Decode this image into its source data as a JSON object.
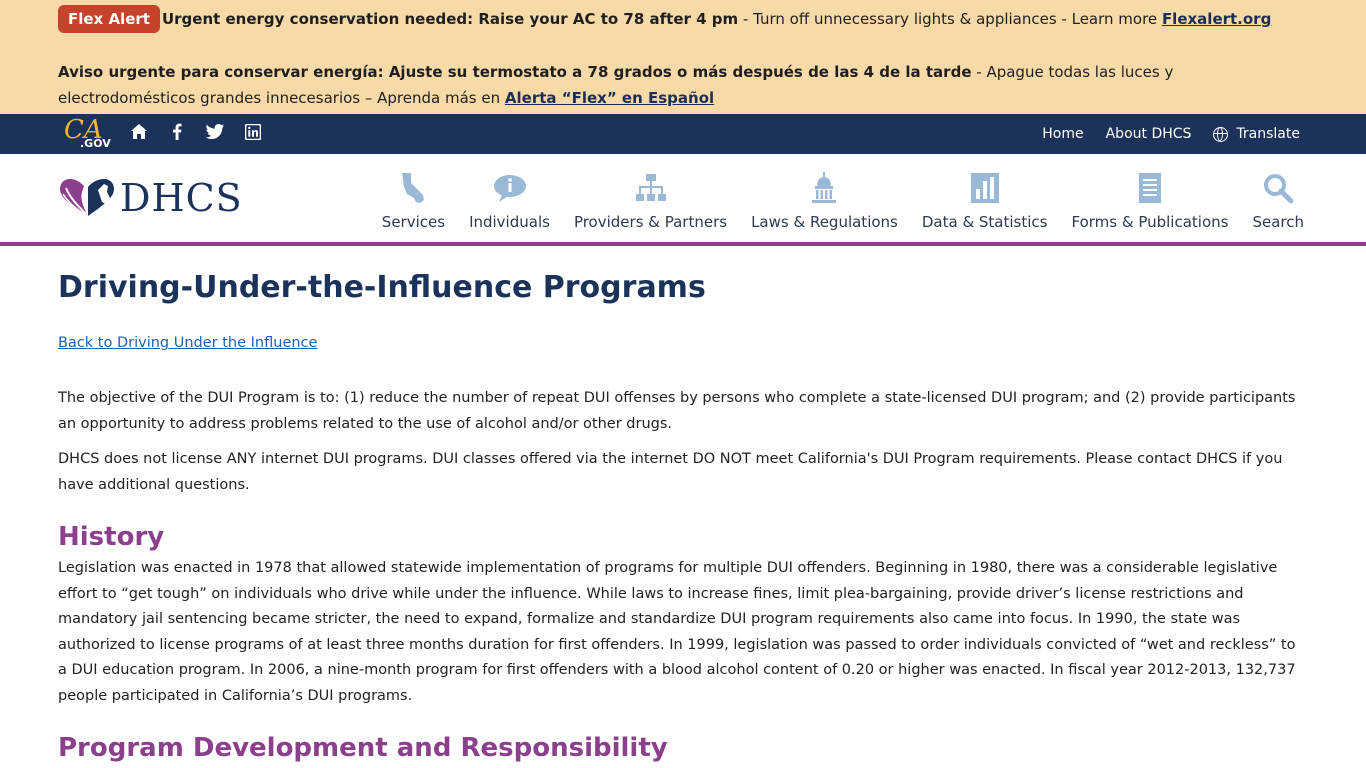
{
  "alert": {
    "badge": "Flex Alert",
    "en_bold": "Urgent energy conservation needed: Raise your AC to 78 after 4 pm",
    "en_rest": " - Turn off unnecessary lights & appliances - Learn more ",
    "en_link": "Flexalert.org",
    "es_bold": "Aviso urgente para conservar energía: Ajuste su termostato a 78 grados o más después de las 4 de la tarde",
    "es_rest": " - Apague todas las luces y electrodomésticos grandes innecesarios – Aprenda más en ",
    "es_link": "Alerta “Flex” en Español"
  },
  "utility": {
    "ca_logo": "CA",
    "gov_text": ".GOV",
    "icons": [
      "home-icon",
      "facebook-icon",
      "twitter-icon",
      "linkedin-icon"
    ],
    "links": [
      "Home",
      "About DHCS"
    ],
    "translate": "Translate"
  },
  "header": {
    "logo_text": "DHCS",
    "nav": [
      {
        "label": "Services",
        "icon": "california-icon"
      },
      {
        "label": "Individuals",
        "icon": "info-icon"
      },
      {
        "label": "Providers & Partners",
        "icon": "org-chart-icon"
      },
      {
        "label": "Laws & Regulations",
        "icon": "capitol-icon"
      },
      {
        "label": "Data & Statistics",
        "icon": "bar-chart-icon"
      },
      {
        "label": "Forms & Publications",
        "icon": "document-icon"
      },
      {
        "label": "Search",
        "icon": "search-icon"
      }
    ]
  },
  "content": {
    "title": "Driving-Under-the-Influence Programs",
    "back_link": "Back to Driving Under the Influence",
    "intro_1": "The objective of the DUI Program is to: (1) reduce the number of repeat DUI offenses by persons who complete a state-licensed DUI program; and (2) provide participants an opportunity to address problems related to the use of alcohol and/or other drugs.",
    "intro_2": "DHCS does not license ANY internet DUI programs.  DUI classes offered via the internet DO NOT meet California's DUI Program requirements.  Please contact DHCS if you have additional questions.",
    "history_heading": "History",
    "history_text": "Legislation was enacted in 1978 that allowed statewide implementation of programs for multiple DUI offenders. Beginning in 1980, there was a considerable legislative effort to “get tough” on individuals who drive while under the influence. While laws to increase fines, limit plea-bargaining, provide driver’s license restrictions and mandatory jail sentencing became stricter, the need to expand, formalize and standardize DUI program requirements also came into focus. In 1990, the state was authorized to license programs of at least three months duration for first offenders. In 1999, legislation was passed to order individuals convicted of “wet and reckless” to a DUI education program. In 2006, a nine-month program for first offenders with a blood alcohol content of 0.20 or higher was enacted. In fiscal year 2012-2013, 132,737 people participated in California’s DUI programs.",
    "next_heading": "Program Development and Responsibility"
  },
  "colors": {
    "alert_bg": "#f8d9a8",
    "badge_bg": "#c5432a",
    "navy": "#1b325b",
    "purple": "#8b3f8c",
    "nav_icon": "#9ab9d6",
    "link": "#1b62b3"
  }
}
